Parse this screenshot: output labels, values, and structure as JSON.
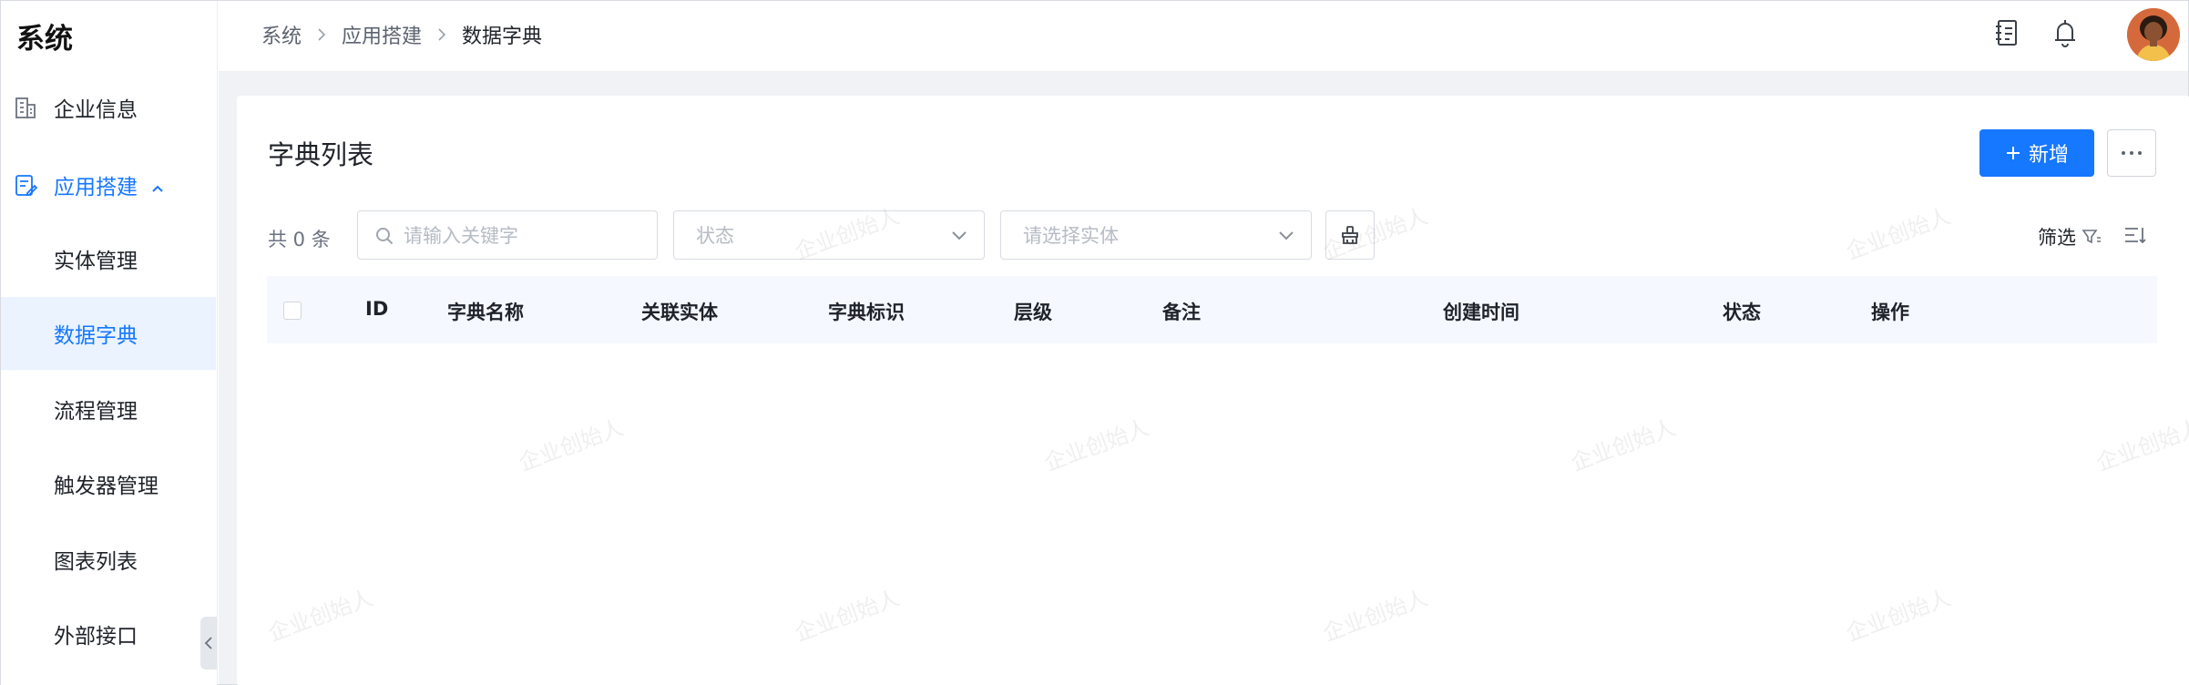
{
  "sidebar": {
    "brand": "系统",
    "items": [
      {
        "label": "企业信息"
      },
      {
        "label": "应用搭建"
      },
      {
        "label": "实体管理"
      },
      {
        "label": "数据字典"
      },
      {
        "label": "流程管理"
      },
      {
        "label": "触发器管理"
      },
      {
        "label": "图表列表"
      },
      {
        "label": "外部接口"
      }
    ]
  },
  "breadcrumb": [
    "系统",
    "应用搭建",
    "数据字典"
  ],
  "page": {
    "title": "字典列表",
    "add_button": "新增",
    "count_text": "共 0 条",
    "search_placeholder": "请输入关键字",
    "status_placeholder": "状态",
    "entity_placeholder": "请选择实体",
    "filter_label": "筛选"
  },
  "table": {
    "columns": [
      "ID",
      "字典名称",
      "关联实体",
      "字典标识",
      "层级",
      "备注",
      "创建时间",
      "状态",
      "操作"
    ]
  },
  "watermark": "企业创始人",
  "colors": {
    "accent": "#1677ff",
    "selected_bg": "#eaf3ff",
    "table_header_bg": "#f5f9ff"
  }
}
